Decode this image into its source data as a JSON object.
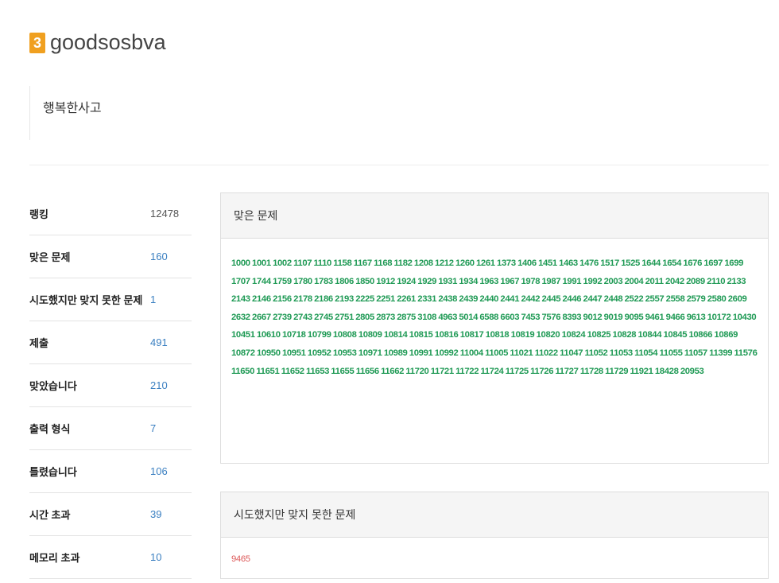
{
  "header": {
    "badge": "3",
    "username": "goodsosbva",
    "status_message": "행복한사고"
  },
  "stats": [
    {
      "label": "랭킹",
      "value": "12478",
      "kind": "rank"
    },
    {
      "label": "맞은 문제",
      "value": "160"
    },
    {
      "label": "시도했지만 맞지 못한 문제",
      "value": "1"
    },
    {
      "label": "제출",
      "value": "491"
    },
    {
      "label": "맞았습니다",
      "value": "210"
    },
    {
      "label": "출력 형식",
      "value": "7"
    },
    {
      "label": "틀렸습니다",
      "value": "106"
    },
    {
      "label": "시간 초과",
      "value": "39"
    },
    {
      "label": "메모리 초과",
      "value": "10"
    }
  ],
  "solved_panel": {
    "title": "맞은 문제",
    "problems": [
      "1000",
      "1001",
      "1002",
      "1107",
      "1110",
      "1158",
      "1167",
      "1168",
      "1182",
      "1208",
      "1212",
      "1260",
      "1261",
      "1373",
      "1406",
      "1451",
      "1463",
      "1476",
      "1517",
      "1525",
      "1644",
      "1654",
      "1676",
      "1697",
      "1699",
      "1707",
      "1744",
      "1759",
      "1780",
      "1783",
      "1806",
      "1850",
      "1912",
      "1924",
      "1929",
      "1931",
      "1934",
      "1963",
      "1967",
      "1978",
      "1987",
      "1991",
      "1992",
      "2003",
      "2004",
      "2011",
      "2042",
      "2089",
      "2110",
      "2133",
      "2143",
      "2146",
      "2156",
      "2178",
      "2186",
      "2193",
      "2225",
      "2251",
      "2261",
      "2331",
      "2438",
      "2439",
      "2440",
      "2441",
      "2442",
      "2445",
      "2446",
      "2447",
      "2448",
      "2522",
      "2557",
      "2558",
      "2579",
      "2580",
      "2609",
      "2632",
      "2667",
      "2739",
      "2743",
      "2745",
      "2751",
      "2805",
      "2873",
      "2875",
      "3108",
      "4963",
      "5014",
      "6588",
      "6603",
      "7453",
      "7576",
      "8393",
      "9012",
      "9019",
      "9095",
      "9461",
      "9466",
      "9613",
      "10172",
      "10430",
      "10451",
      "10610",
      "10718",
      "10799",
      "10808",
      "10809",
      "10814",
      "10815",
      "10816",
      "10817",
      "10818",
      "10819",
      "10820",
      "10824",
      "10825",
      "10828",
      "10844",
      "10845",
      "10866",
      "10869",
      "10872",
      "10950",
      "10951",
      "10952",
      "10953",
      "10971",
      "10989",
      "10991",
      "10992",
      "11004",
      "11005",
      "11021",
      "11022",
      "11047",
      "11052",
      "11053",
      "11054",
      "11055",
      "11057",
      "11399",
      "11576",
      "11650",
      "11651",
      "11652",
      "11653",
      "11655",
      "11656",
      "11662",
      "11720",
      "11721",
      "11722",
      "11724",
      "11725",
      "11726",
      "11727",
      "11728",
      "11729",
      "11921",
      "18428",
      "20953"
    ]
  },
  "failed_panel": {
    "title": "시도했지만 맞지 못한 문제",
    "problems": [
      "9465"
    ]
  },
  "colors": {
    "solved": "#1f9a55",
    "failed": "#dd5a5a",
    "stat_link": "#3a7fc1",
    "badge": "#f0a020"
  }
}
